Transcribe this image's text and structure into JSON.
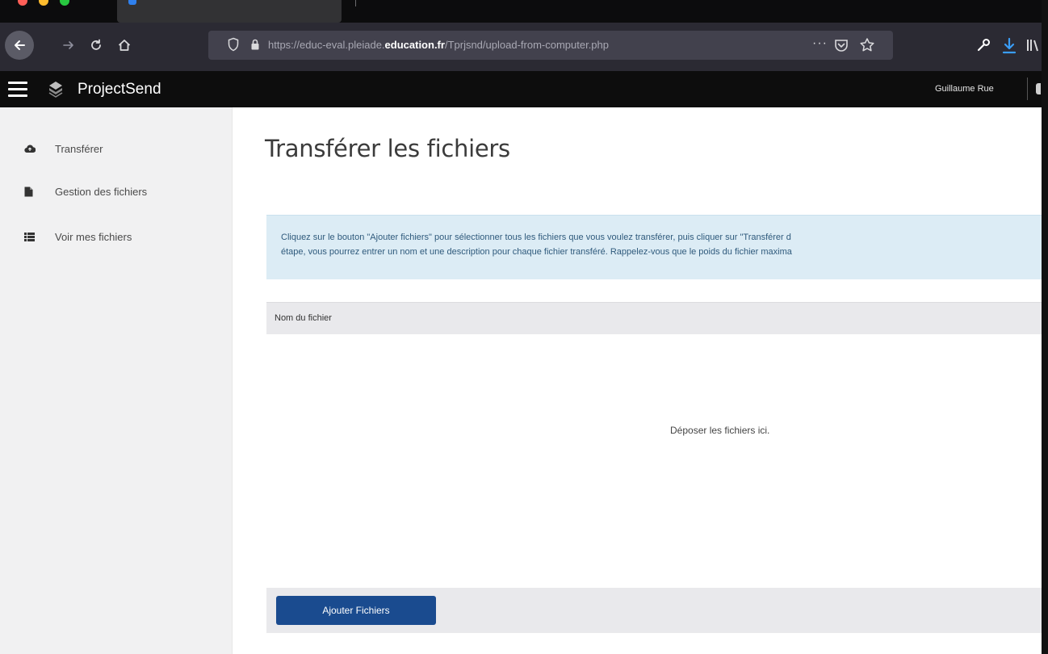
{
  "browser": {
    "traffic_colors": [
      "#ff5f57",
      "#febc2e",
      "#28c840"
    ],
    "url_prefix": "https://educ-eval.pleiade.",
    "url_domain": "education.fr",
    "url_path": "/Tprjsnd/upload-from-computer.php",
    "url_more": "···"
  },
  "app": {
    "brand": "ProjectSend",
    "user": "Guillaume Rue"
  },
  "sidebar": {
    "items": [
      {
        "label": "Transférer",
        "icon": "cloud-upload-icon"
      },
      {
        "label": "Gestion des fichiers",
        "icon": "file-icon"
      },
      {
        "label": "Voir mes fichiers",
        "icon": "list-icon"
      }
    ]
  },
  "main": {
    "title": "Transférer les fichiers",
    "info_line1": "Cliquez sur le bouton \"Ajouter fichiers\" pour sélectionner tous les fichiers que vous voulez transférer, puis cliquer sur \"Transférer d",
    "info_line2": "étape, vous pourrez entrer un nom et une description pour chaque fichier transféré. Rappelez-vous que le poids du fichier maxima",
    "column_header": "Nom du fichier",
    "drop_text": "Déposer les fichiers ici.",
    "add_button": "Ajouter Fichiers"
  },
  "colors": {
    "accent": "#1a4b8f",
    "info_bg": "#dcecf5",
    "header_bg": "#0d0d0d"
  }
}
